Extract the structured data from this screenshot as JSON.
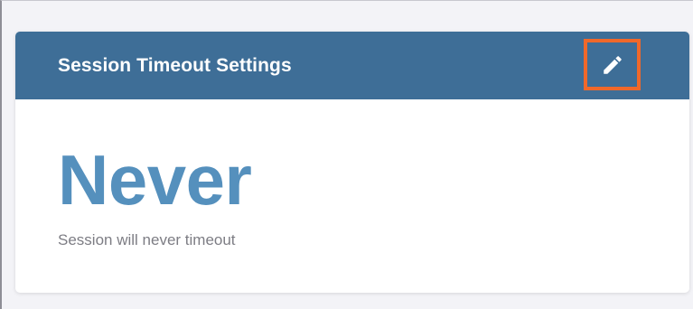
{
  "card": {
    "title": "Session Timeout Settings",
    "edit_icon": "pencil-icon",
    "value": "Never",
    "description": "Session will never timeout"
  },
  "colors": {
    "header_bg": "#3e6e97",
    "value_text": "#5590bd",
    "highlight_border": "#f0682a"
  }
}
